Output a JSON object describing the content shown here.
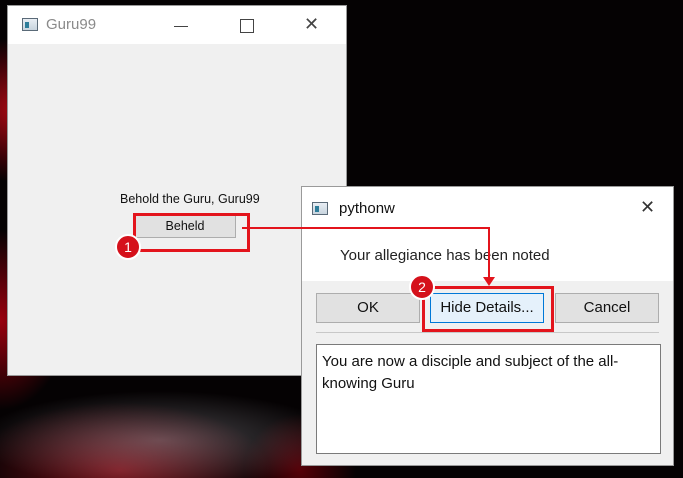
{
  "main_window": {
    "title": "Guru99",
    "label": "Behold the Guru, Guru99",
    "button": "Beheld",
    "minimize": "—",
    "close": "✕"
  },
  "dialog": {
    "title": "pythonw",
    "message": "Your allegiance has been noted",
    "close": "✕",
    "buttons": {
      "ok": "OK",
      "hide_details": "Hide Details...",
      "cancel": "Cancel"
    },
    "details_text": "You are now a disciple and subject of the all-knowing Guru"
  },
  "annotations": {
    "badge_1": "1",
    "badge_2": "2",
    "highlight_color": "#e3141c"
  },
  "icons": [
    "app-window-icon",
    "minimize-icon",
    "maximize-icon",
    "close-icon"
  ]
}
